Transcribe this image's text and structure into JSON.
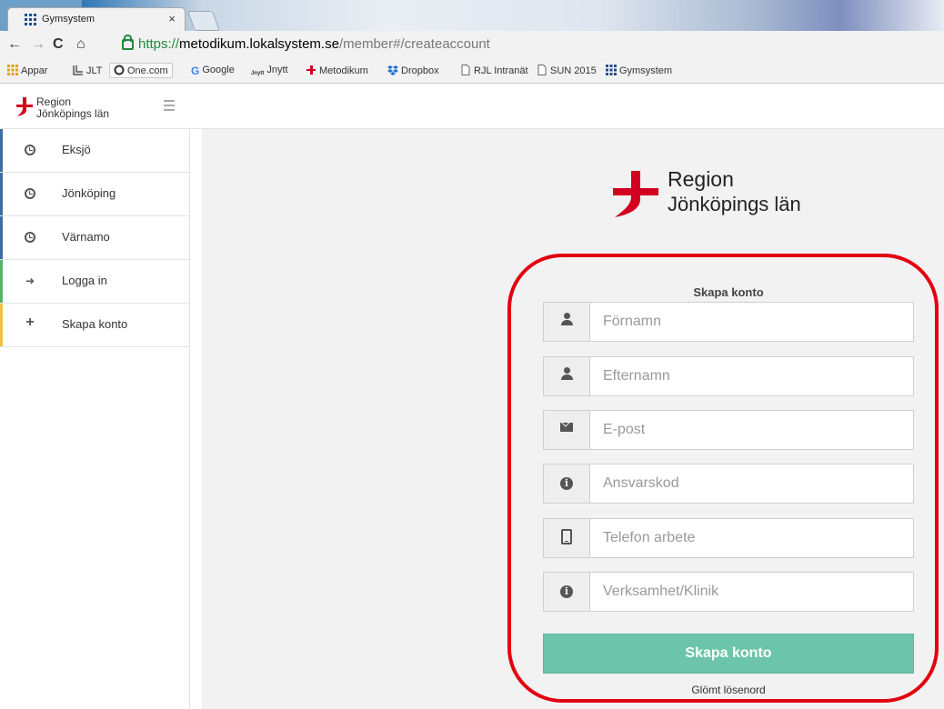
{
  "browser": {
    "tab_title": "Gymsystem",
    "tab_close": "×",
    "url_scheme": "https://",
    "url_host": "metodikum.lokalsystem.se",
    "url_path": "/member#/createaccount",
    "bookmarks": [
      {
        "label": "Appar"
      },
      {
        "label": "JLT"
      },
      {
        "label": "One.com"
      },
      {
        "label": "Google"
      },
      {
        "label": "Jnytt"
      },
      {
        "label": "Metodikum"
      },
      {
        "label": "Dropbox"
      },
      {
        "label": "RJL Intranät"
      },
      {
        "label": "SUN 2015"
      },
      {
        "label": "Gymsystem"
      }
    ]
  },
  "brand": {
    "line1": "Region",
    "line2": "Jönköpings län",
    "color": "#d2001e"
  },
  "sidebar": {
    "items": [
      {
        "label": "Eksjö",
        "icon": "clock-icon",
        "accent": "#3a6ea5"
      },
      {
        "label": "Jönköping",
        "icon": "clock-icon",
        "accent": "#3a6ea5"
      },
      {
        "label": "Värnamo",
        "icon": "clock-icon",
        "accent": "#3a6ea5"
      },
      {
        "label": "Logga in",
        "icon": "sign-in-icon",
        "accent": "#55b46d"
      },
      {
        "label": "Skapa konto",
        "icon": "plus-icon",
        "accent": "#f0c040"
      }
    ]
  },
  "form": {
    "title": "Skapa konto",
    "fields": [
      {
        "placeholder": "Förnamn",
        "icon": "user-icon"
      },
      {
        "placeholder": "Efternamn",
        "icon": "user-icon"
      },
      {
        "placeholder": "E-post",
        "icon": "envelope-icon"
      },
      {
        "placeholder": "Ansvarskod",
        "icon": "info-icon"
      },
      {
        "placeholder": "Telefon arbete",
        "icon": "phone-icon"
      },
      {
        "placeholder": "Verksamhet/Klinik",
        "icon": "info-icon"
      }
    ],
    "submit_label": "Skapa konto",
    "forgot_label": "Glömt lösenord",
    "submit_color": "#6cc5a8",
    "highlight_color": "#e3000f"
  }
}
